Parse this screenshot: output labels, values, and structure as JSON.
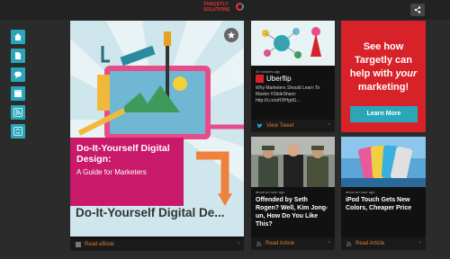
{
  "header": {
    "logo_line1": "TARGETLY",
    "logo_line2": "SOLUTIONS"
  },
  "iconbar": {
    "items": [
      "home-icon",
      "document-icon",
      "chat-icon",
      "video-icon",
      "rss-icon",
      "refresh-icon"
    ]
  },
  "feature": {
    "box_title": "Do-It-Yourself Digital Design:",
    "box_subtitle": "A Guide for Marketers",
    "big_title": "Do-It-Yourself Digital De...",
    "footer_label": "Read eBook"
  },
  "uberflip": {
    "time": "40 minutes ago",
    "brand": "Uberflip",
    "body": "Why Marketers Should Learn To Master #SlideShare: http://t.co/aH2fHgdU...",
    "footer_label": "View Tweet"
  },
  "ad": {
    "line1": "See how Targetly can help with ",
    "line_em": "your",
    "line2": " marketing!",
    "button": "Learn More"
  },
  "news1": {
    "time": "about an hour ago",
    "title": "Offended by Seth Rogen? Well, Kim Jong-un, How Do You Like This?",
    "footer_label": "Read Article"
  },
  "news2": {
    "time": "about an hour ago",
    "title": "iPod Touch Gets New Colors, Cheaper Price",
    "footer_label": "Read Article"
  },
  "colors": {
    "accent_teal": "#2aa6b8",
    "brand_red": "#d8222a",
    "feature_pink": "#c8196b",
    "link_orange": "#e07b2a"
  }
}
